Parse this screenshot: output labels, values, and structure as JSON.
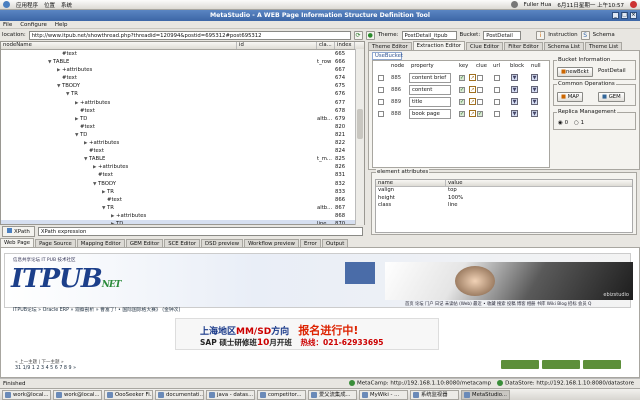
{
  "top_panel": {
    "menus": [
      "应用程序",
      "位置",
      "系统"
    ],
    "user": "Fuller Hua",
    "datetime": "6月11日星期一 上午10:57"
  },
  "window": {
    "title": "MetaStudio - A WEB Page Information Structure Definition Tool",
    "menus": [
      "File",
      "Configure",
      "Help"
    ]
  },
  "location": {
    "label": "location:",
    "url": "http://www.itpub.net/showthread.php?threadid=120994&postid=695312#post695312",
    "theme_label": "Theme:",
    "theme_value": "PostDetail_itpub",
    "bucket_label": "Bucket:",
    "bucket_value": "PostDetail",
    "instruction_label": "Instruction",
    "schema_label": "Schema"
  },
  "tree": {
    "columns": [
      "nodeName",
      "id",
      "cla...",
      "index"
    ],
    "rows": [
      {
        "indent": 6,
        "tw": "",
        "name": "#text",
        "cl": "",
        "ix": "665"
      },
      {
        "indent": 5,
        "tw": "▼",
        "name": "TABLE",
        "cl": "t_row",
        "ix": "666"
      },
      {
        "indent": 6,
        "tw": "▶",
        "name": "+attributes",
        "cl": "",
        "ix": "667"
      },
      {
        "indent": 6,
        "tw": "",
        "name": "#text",
        "cl": "",
        "ix": "674"
      },
      {
        "indent": 6,
        "tw": "▼",
        "name": "TBODY",
        "cl": "",
        "ix": "675"
      },
      {
        "indent": 7,
        "tw": "▼",
        "name": "TR",
        "cl": "",
        "ix": "676"
      },
      {
        "indent": 8,
        "tw": "▶",
        "name": "+attributes",
        "cl": "",
        "ix": "677"
      },
      {
        "indent": 8,
        "tw": "",
        "name": "#text",
        "cl": "",
        "ix": "678"
      },
      {
        "indent": 8,
        "tw": "▶",
        "name": "TD",
        "cl": "altb...",
        "ix": "679"
      },
      {
        "indent": 8,
        "tw": "",
        "name": "#text",
        "cl": "",
        "ix": "820"
      },
      {
        "indent": 8,
        "tw": "▼",
        "name": "TD",
        "cl": "",
        "ix": "821"
      },
      {
        "indent": 9,
        "tw": "▶",
        "name": "+attributes",
        "cl": "",
        "ix": "822"
      },
      {
        "indent": 9,
        "tw": "",
        "name": "#text",
        "cl": "",
        "ix": "824"
      },
      {
        "indent": 9,
        "tw": "▼",
        "name": "TABLE",
        "cl": "t_m...",
        "ix": "825"
      },
      {
        "indent": 10,
        "tw": "▶",
        "name": "+attributes",
        "cl": "",
        "ix": "826"
      },
      {
        "indent": 10,
        "tw": "",
        "name": "#text",
        "cl": "",
        "ix": "831"
      },
      {
        "indent": 10,
        "tw": "▼",
        "name": "TBODY",
        "cl": "",
        "ix": "832"
      },
      {
        "indent": 11,
        "tw": "▶",
        "name": "TR",
        "cl": "",
        "ix": "833"
      },
      {
        "indent": 11,
        "tw": "",
        "name": "#text",
        "cl": "",
        "ix": "866"
      },
      {
        "indent": 11,
        "tw": "▼",
        "name": "TR",
        "cl": "altb...",
        "ix": "867"
      },
      {
        "indent": 12,
        "tw": "▶",
        "name": "+attributes",
        "cl": "",
        "ix": "868"
      },
      {
        "indent": 12,
        "tw": "▶",
        "name": "TD",
        "cl": "line",
        "ix": "870",
        "selected": true
      },
      {
        "indent": 11,
        "tw": "",
        "name": "#text",
        "cl": "",
        "ix": "971"
      }
    ]
  },
  "xpath": {
    "button": "XPath",
    "field": "XPath expression"
  },
  "right_tabs": [
    "Theme Editor",
    "Extraction Editor",
    "Clue Editor",
    "Filter Editor",
    "Schema List",
    "Theme List"
  ],
  "extraction": {
    "bucket_tab": "UseBucket",
    "headers": [
      "node",
      "property",
      "key",
      "clue",
      "url",
      "block",
      "null"
    ],
    "rows": [
      {
        "id": "885",
        "property": "content brief",
        "key": true,
        "clue": false,
        "url": false
      },
      {
        "id": "886",
        "property": "content",
        "key": true,
        "clue": false,
        "url": false
      },
      {
        "id": "889",
        "property": "title",
        "key": true,
        "clue": false,
        "url": false
      },
      {
        "id": "888",
        "property": "book page",
        "key": true,
        "clue": true,
        "url": false
      }
    ],
    "bucket_info": {
      "title": "Bucket Information",
      "button": "newBckt",
      "value": "PostDetail"
    },
    "common_ops": {
      "title": "Common Operations",
      "map": "MAP",
      "gem": "GEM"
    },
    "replica": {
      "title": "Replica Management",
      "options": [
        "0",
        "1"
      ]
    }
  },
  "attributes": {
    "title": "element attributes",
    "columns": [
      "name",
      "value"
    ],
    "rows": [
      {
        "name": "valign",
        "value": "top"
      },
      {
        "name": "height",
        "value": "100%"
      },
      {
        "name": "class",
        "value": "line"
      }
    ]
  },
  "bottom_tabs": [
    "Web Page",
    "Page Source",
    "Mapping Editor",
    "GEM Editor",
    "SCE Editor",
    "DSD preview",
    "Workflow preview",
    "Error",
    "Output"
  ],
  "webpage": {
    "logo_tagline": "信息共享论坛 IT PUB 技术社区",
    "logo_text": "ITPUB",
    "logo_suffix": "NET",
    "banner_tag": "ebizstudio",
    "nav_text": "首页 论坛 门户 日记 未读帖 (Web) 最近 • 收藏 搜索 投稿 博客 相册 书库 Wiki Blog 招标 会员 Q",
    "breadcrumb": "ITPUB论坛 » Oracle ERP » 观察剖析 » 曹富了! • 国际国际格大赛》 (金钟次)",
    "ad_line1": "上海地区",
    "ad_mmsd": "MM/SD",
    "ad_line1b": "方向",
    "ad_enroll": "报名进行中!",
    "ad_line2a": "SAP 硕士研修班",
    "ad_month": "10",
    "ad_line2b": "月开班",
    "ad_hotline": "热线：021-62933695",
    "pager_prev": "« 上一主题 | 下一主题 »",
    "pager": "31  1/9  1 2 3 4 5 6 7 8 9  »"
  },
  "status": {
    "left": "Finished",
    "metacamp": "MetaCamp: http://192.168.1.10:8080/metacamp",
    "datastore": "DataStore: http://192.168.1.10:8080/datastore"
  },
  "taskbar": [
    "work@local...",
    "work@local...",
    "OooSeeker Fi...",
    "documentati...",
    "java - datas...",
    "competitor...",
    "爱父流集成...",
    "MyWiki - ...",
    "系统监视器",
    "MetaStudio..."
  ]
}
